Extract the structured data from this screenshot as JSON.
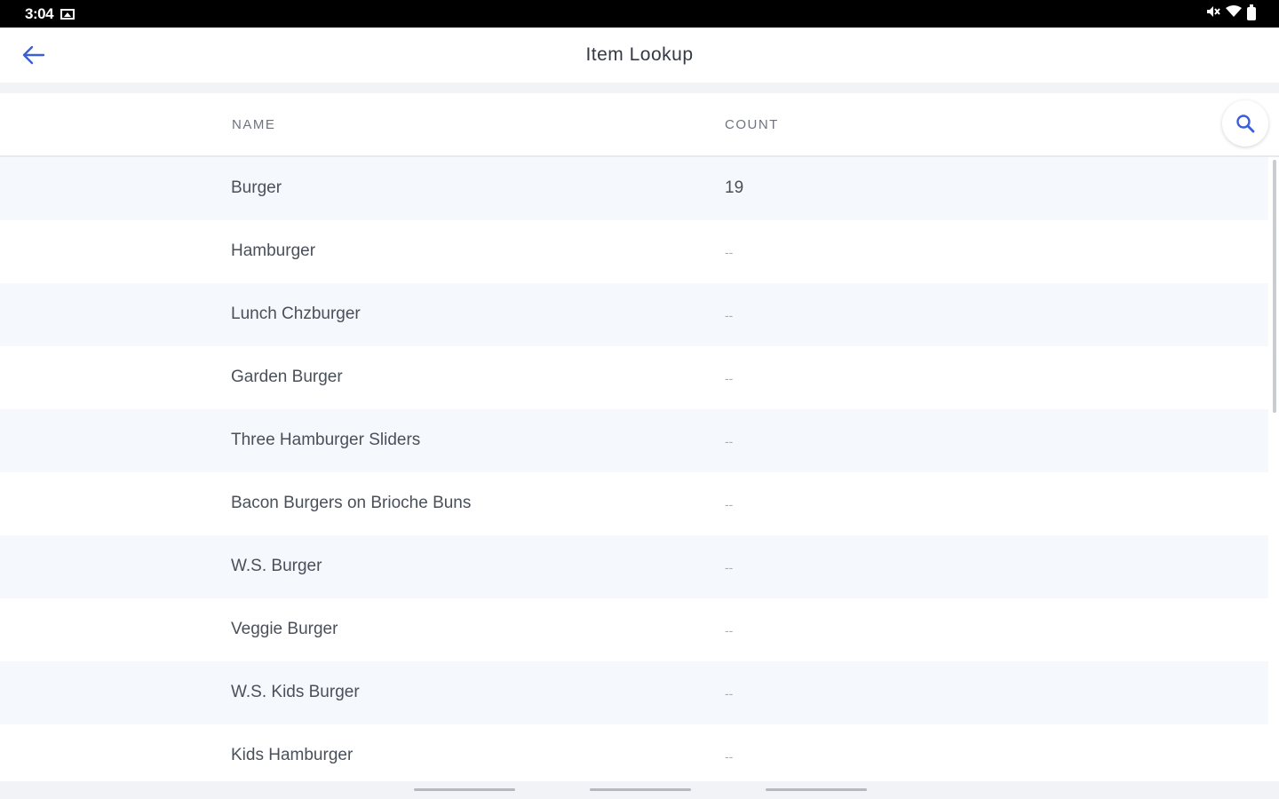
{
  "status_bar": {
    "time": "3:04",
    "icons": [
      "image-icon",
      "mute-icon",
      "wifi-icon",
      "battery-icon"
    ]
  },
  "app_bar": {
    "title": "Item Lookup",
    "back_icon": "arrow-left-icon"
  },
  "table": {
    "columns": {
      "name": "NAME",
      "count": "COUNT"
    },
    "search_icon": "search-icon",
    "rows": [
      {
        "name": "Burger",
        "count": "19"
      },
      {
        "name": "Hamburger",
        "count": "--"
      },
      {
        "name": "Lunch Chzburger",
        "count": "--"
      },
      {
        "name": "Garden Burger",
        "count": "--"
      },
      {
        "name": "Three Hamburger Sliders",
        "count": "--"
      },
      {
        "name": "Bacon Burgers on Brioche Buns",
        "count": "--"
      },
      {
        "name": "W.S. Burger",
        "count": "--"
      },
      {
        "name": "Veggie Burger",
        "count": "--"
      },
      {
        "name": "W.S. Kids Burger",
        "count": "--"
      },
      {
        "name": "Kids Hamburger",
        "count": "--"
      }
    ]
  },
  "colors": {
    "accent": "#3a5fd9",
    "row_alt_bg": "#f5f8fc",
    "status_bar_bg": "#000000"
  }
}
